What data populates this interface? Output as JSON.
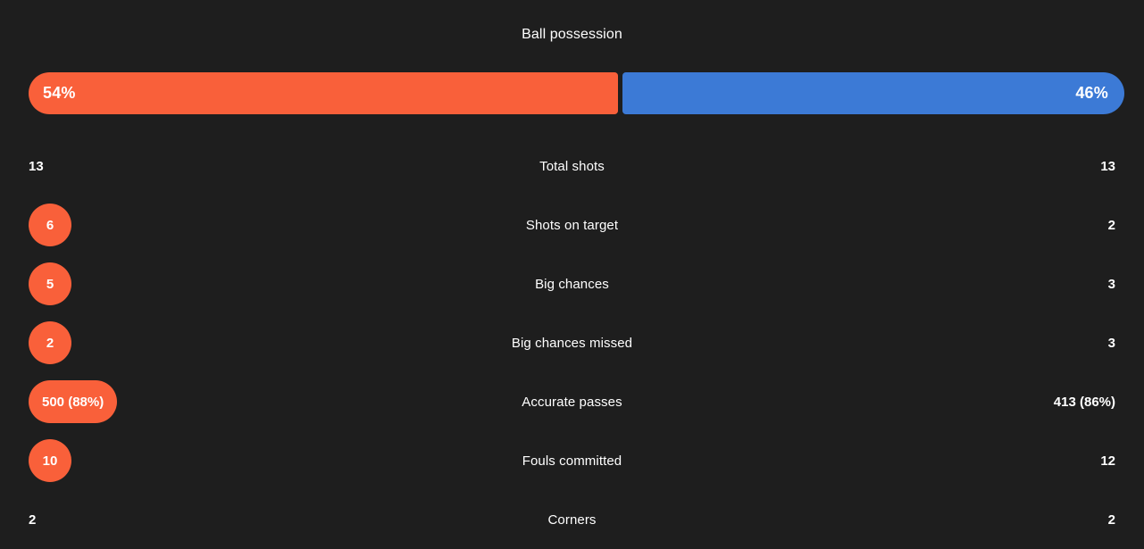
{
  "panel": {
    "title": "Ball possession",
    "accent_home": "#f9603a",
    "accent_away": "#3c7ad6",
    "background": "#1e1e1e"
  },
  "possession": {
    "home_label": "54%",
    "away_label": "46%",
    "home_percent": 54,
    "away_percent": 46
  },
  "stats": [
    {
      "label": "Total shots",
      "home": "13",
      "away": "13",
      "home_highlight": false,
      "away_highlight": false
    },
    {
      "label": "Shots on target",
      "home": "6",
      "away": "2",
      "home_highlight": true,
      "away_highlight": false
    },
    {
      "label": "Big chances",
      "home": "5",
      "away": "3",
      "home_highlight": true,
      "away_highlight": false
    },
    {
      "label": "Big chances missed",
      "home": "2",
      "away": "3",
      "home_highlight": true,
      "away_highlight": false
    },
    {
      "label": "Accurate passes",
      "home": "500 (88%)",
      "away": "413 (86%)",
      "home_highlight": true,
      "away_highlight": false
    },
    {
      "label": "Fouls committed",
      "home": "10",
      "away": "12",
      "home_highlight": true,
      "away_highlight": false
    },
    {
      "label": "Corners",
      "home": "2",
      "away": "2",
      "home_highlight": false,
      "away_highlight": false
    }
  ]
}
